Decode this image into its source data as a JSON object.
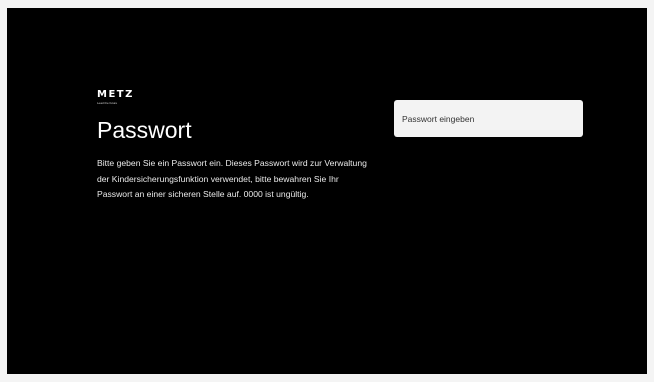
{
  "brand": {
    "name": "METZ",
    "tagline": "Lead the future"
  },
  "page": {
    "title": "Passwort",
    "description": "Bitte geben Sie ein Passwort ein. Dieses Passwort wird zur Verwaltung der Kindersicherungsfunktion verwendet, bitte bewahren Sie Ihr Passwort an einer sicheren Stelle auf. 0000 ist ungültig."
  },
  "password_field": {
    "placeholder": "Passwort eingeben"
  },
  "colors": {
    "background": "#000000",
    "text": "#ffffff",
    "input_background": "#f3f3f3"
  }
}
